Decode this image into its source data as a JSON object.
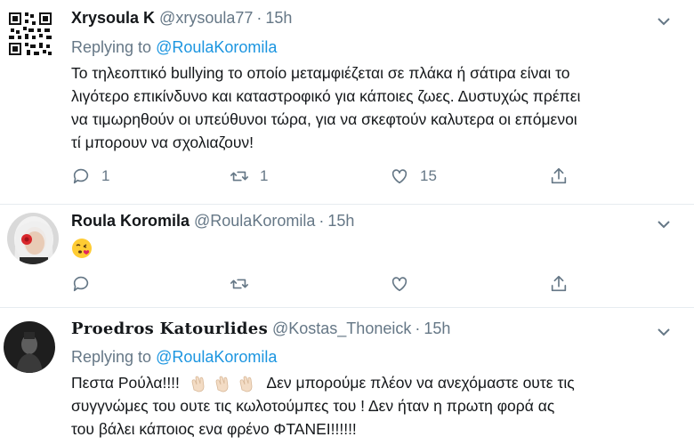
{
  "tweets": [
    {
      "name": "Xrysoula K",
      "handle": "@xrysoula77",
      "time": "15h",
      "replying_prefix": "Replying to",
      "replying_to": "@RoulaKoromila",
      "text_lines": [
        "Το τηλεοπτικό bullying το οποίο μεταμφιέζεται σε πλάκα ή σάτιρα είναι το",
        "λιγότερο επικίνδυνο και καταστροφικό για κάποιες ζωες. Δυστυχώς πρέπει",
        "να τιμωρηθούν οι υπεύθυνοι τώρα, για να σκεφτούν καλυτερα οι επόμενοι",
        "τί μπορουν να σχολιαζουν!"
      ],
      "replies": "1",
      "retweets": "1",
      "likes": "15",
      "avatar_icon": "qr-code-icon"
    },
    {
      "name": "Roula Koromila",
      "handle": "@RoulaKoromila",
      "time": "15h",
      "emoji": "face-blowing-kiss",
      "replies": "",
      "retweets": "",
      "likes": "",
      "avatar_icon": "profile-photo"
    },
    {
      "name": "Proedros Katourlides",
      "handle": "@Kostas_Thoneick",
      "time": "15h",
      "replying_prefix": "Replying to",
      "replying_to": "@RoulaKoromila",
      "text_line1_a": "Πεστα Ρούλα!!!!",
      "text_line1_b": "Δεν μπορούμε πλέον να ανεχόμαστε ουτε τις",
      "text_line2": "συγγνώμες του ουτε τις κωλοτούμπες του ! Δεν ήταν η πρωτη φορά ας",
      "text_line3": "του βάλει κάποιος ενα φρένο ΦΤΑΝΕΙ!!!!!!",
      "clap_emojis": [
        "clapping-hands-light",
        "clapping-hands-light",
        "clapping-hands-light"
      ],
      "avatar_icon": "profile-photo"
    }
  ],
  "colors": {
    "link": "#1b95e0",
    "secondary": "#657786",
    "text": "#14171a",
    "divider": "#e6ecf0"
  }
}
